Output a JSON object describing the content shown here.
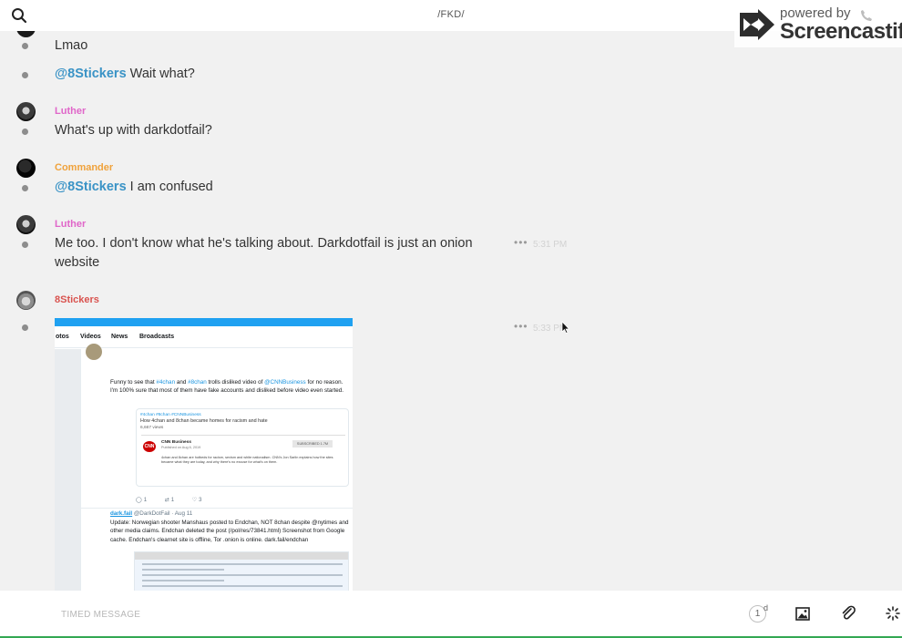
{
  "header": {
    "title": "/FKD/"
  },
  "watermark": {
    "powered": "powered by",
    "brand": "Screencastify"
  },
  "messages": {
    "m1": {
      "text": "Lmao"
    },
    "m2": {
      "mention": "@8Stickers",
      "text": " Wait what?"
    },
    "m3": {
      "author": "Luther",
      "text": "What's up with darkdotfail?"
    },
    "m4": {
      "author": "Commander",
      "mention": "@8Stickers",
      "text": " I am confused"
    },
    "m5": {
      "author": "Luther",
      "text_line1": "Me too. I don't know what he's talking about. Darkdotfail is just an onion",
      "text_line2": "website",
      "time": "5:31 PM"
    },
    "m6": {
      "author": "8Stickers",
      "time": "5:33 PM"
    }
  },
  "colors": {
    "luther": "#e066c9",
    "commander": "#f0a23b",
    "stickers": "#d9534f",
    "mention": "#3a93c6"
  },
  "attachment": {
    "tabs": [
      "otos",
      "Videos",
      "News",
      "Broadcasts"
    ],
    "tweet1_a": "Funny to see that ",
    "tweet1_tag1": "#4chan",
    "tweet1_b": " and ",
    "tweet1_tag2": "#8chan",
    "tweet1_c": " trolls disliked video of ",
    "tweet1_handle": "@CNNBusiness",
    "tweet1_d": " for no reason. I'm 100% sure that most of them have fake accounts and disliked before video even started.",
    "card_tags": "#4chan #8chan #CNNBusiness",
    "card_title": "How 4chan and 8chan became homes for racism and hate",
    "card_views": "6,667 views",
    "card_channel": "CNN Business",
    "card_published": "Published on Aug 6, 2019",
    "card_subscribe": "SUBSCRIBED 1.7M",
    "card_desc": "4chan and 8chan are hotbeds for racism, sexism and white nationalism. CNN's Jon Sarlin explains how the sites became what they are today, and why there's no excuse for what's on them.",
    "card_logo": "CNN",
    "reply": "1",
    "retweet": "1",
    "like": "3",
    "tweet2_name": "dark.fail",
    "tweet2_meta": " @DarkDotFail · Aug 11",
    "tweet2_body": "Update: Norwegian shooter Manshaus posted to Endchan, NOT 8chan despite @nytimes and other media claims. Endchan deleted the post (/pol/res/73841.html) Screenshot from Google cache. Endchan's clearnet site is offline, Tor .onion is online. dark.fail/endchan"
  },
  "composer": {
    "placeholder": "TIMED MESSAGE",
    "timer_value": "1",
    "timer_unit": "d"
  }
}
